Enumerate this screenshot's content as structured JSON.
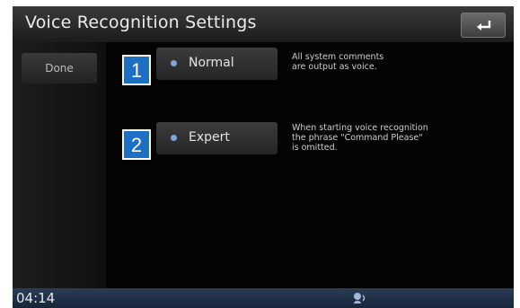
{
  "header": {
    "title": "Voice Recognition Settings",
    "back_icon": "back-arrow-icon"
  },
  "sidebar": {
    "done_label": "Done"
  },
  "options": [
    {
      "badge": "1",
      "label": "Normal",
      "description_line1": "All system comments",
      "description_line2": "are output as voice.",
      "description_line3": ""
    },
    {
      "badge": "2",
      "label": "Expert",
      "description_line1": "When starting voice recognition",
      "description_line2": "the phrase \"Command Please\"",
      "description_line3": "is omitted."
    }
  ],
  "status": {
    "time": "04:14",
    "icon": "voice-status-icon"
  },
  "colors": {
    "badge": "#1e6fc1",
    "status_bar": "#1f3048"
  }
}
